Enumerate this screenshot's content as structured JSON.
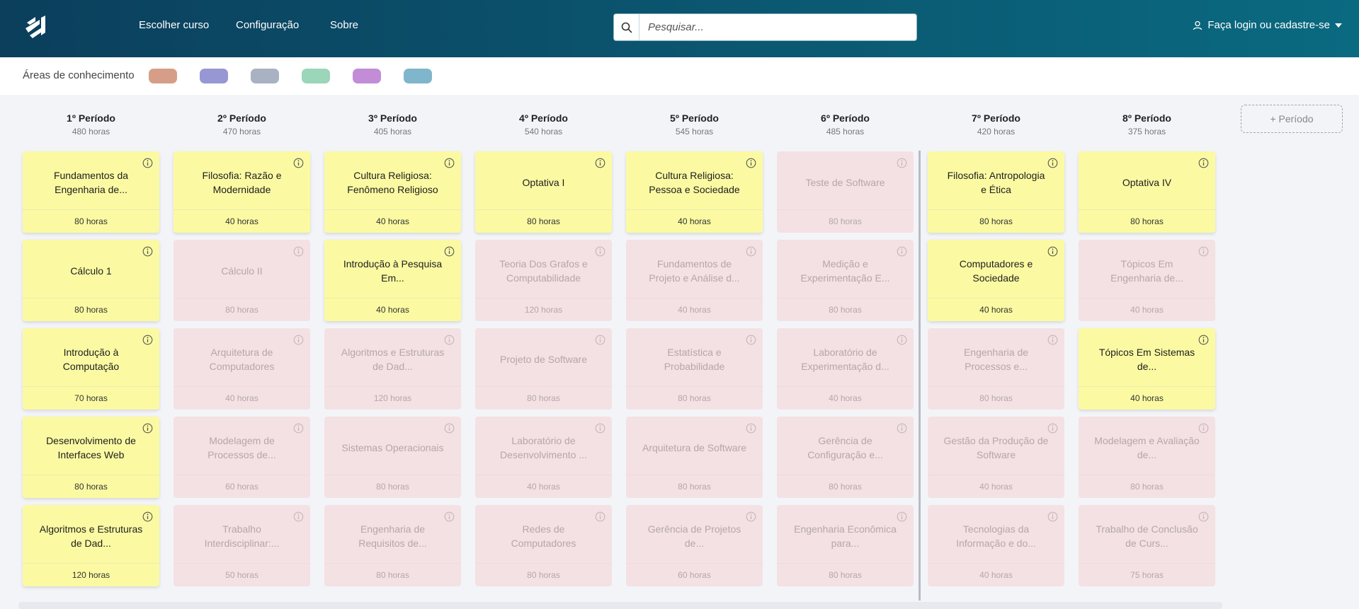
{
  "nav": {
    "items": [
      "Escolher curso",
      "Configuração",
      "Sobre"
    ],
    "search_placeholder": "Pesquisar...",
    "login_label": "Faça login ou cadastre-se"
  },
  "areas": {
    "label": "Áreas de conhecimento",
    "colors": [
      "#d69e88",
      "#9797d3",
      "#a9b2c2",
      "#9bd5ba",
      "#c38cd7",
      "#7fb6cb"
    ]
  },
  "add_period_label": "+ Período",
  "periods": [
    {
      "name": "1º Período",
      "hours": "480 horas",
      "cards": [
        {
          "title": "Fundamentos da Engenharia de...",
          "hours": "80 horas",
          "active": true
        },
        {
          "title": "Cálculo 1",
          "hours": "80 horas",
          "active": true
        },
        {
          "title": "Introdução à Computação",
          "hours": "70 horas",
          "active": true
        },
        {
          "title": "Desenvolvimento de Interfaces Web",
          "hours": "80 horas",
          "active": true
        },
        {
          "title": "Algoritmos e Estruturas de Dad...",
          "hours": "120 horas",
          "active": true
        }
      ]
    },
    {
      "name": "2º Período",
      "hours": "470 horas",
      "cards": [
        {
          "title": "Filosofia: Razão e Modernidade",
          "hours": "40 horas",
          "active": true
        },
        {
          "title": "Cálculo II",
          "hours": "80 horas",
          "active": false
        },
        {
          "title": "Arquitetura de Computadores",
          "hours": "40 horas",
          "active": false
        },
        {
          "title": "Modelagem de Processos de...",
          "hours": "60 horas",
          "active": false
        },
        {
          "title": "Trabalho Interdisciplinar:...",
          "hours": "50 horas",
          "active": false
        }
      ]
    },
    {
      "name": "3º Período",
      "hours": "405 horas",
      "cards": [
        {
          "title": "Cultura Religiosa: Fenômeno Religioso",
          "hours": "40 horas",
          "active": true
        },
        {
          "title": "Introdução à Pesquisa Em...",
          "hours": "40 horas",
          "active": true
        },
        {
          "title": "Algoritmos e Estruturas de Dad...",
          "hours": "120 horas",
          "active": false
        },
        {
          "title": "Sistemas Operacionais",
          "hours": "80 horas",
          "active": false
        },
        {
          "title": "Engenharia de Requisitos de...",
          "hours": "80 horas",
          "active": false
        }
      ]
    },
    {
      "name": "4º Período",
      "hours": "540 horas",
      "cards": [
        {
          "title": "Optativa I",
          "hours": "80 horas",
          "active": true
        },
        {
          "title": "Teoria Dos Grafos e Computabilidade",
          "hours": "120 horas",
          "active": false
        },
        {
          "title": "Projeto de Software",
          "hours": "80 horas",
          "active": false
        },
        {
          "title": "Laboratório de Desenvolvimento ...",
          "hours": "40 horas",
          "active": false
        },
        {
          "title": "Redes de Computadores",
          "hours": "80 horas",
          "active": false
        }
      ]
    },
    {
      "name": "5º Período",
      "hours": "545 horas",
      "cards": [
        {
          "title": "Cultura Religiosa: Pessoa e Sociedade",
          "hours": "40 horas",
          "active": true
        },
        {
          "title": "Fundamentos de Projeto e Análise d...",
          "hours": "40 horas",
          "active": false
        },
        {
          "title": "Estatística e Probabilidade",
          "hours": "80 horas",
          "active": false
        },
        {
          "title": "Arquitetura de Software",
          "hours": "80 horas",
          "active": false
        },
        {
          "title": "Gerência de Projetos de...",
          "hours": "60 horas",
          "active": false
        }
      ]
    },
    {
      "name": "6º Período",
      "hours": "485 horas",
      "cards": [
        {
          "title": "Teste de Software",
          "hours": "80 horas",
          "active": false
        },
        {
          "title": "Medição e Experimentação E...",
          "hours": "80 horas",
          "active": false
        },
        {
          "title": "Laboratório de Experimentação d...",
          "hours": "40 horas",
          "active": false
        },
        {
          "title": "Gerência de Configuração e...",
          "hours": "80 horas",
          "active": false
        },
        {
          "title": "Engenharia Econômica para...",
          "hours": "80 horas",
          "active": false
        }
      ]
    },
    {
      "name": "7º Período",
      "hours": "420 horas",
      "cards": [
        {
          "title": "Filosofia: Antropologia e Ética",
          "hours": "80 horas",
          "active": true
        },
        {
          "title": "Computadores e Sociedade",
          "hours": "40 horas",
          "active": true
        },
        {
          "title": "Engenharia de Processos e...",
          "hours": "80 horas",
          "active": false
        },
        {
          "title": "Gestão da Produção de Software",
          "hours": "40 horas",
          "active": false
        },
        {
          "title": "Tecnologias da Informação e do...",
          "hours": "40 horas",
          "active": false
        }
      ]
    },
    {
      "name": "8º Período",
      "hours": "375 horas",
      "cards": [
        {
          "title": "Optativa IV",
          "hours": "80 horas",
          "active": true
        },
        {
          "title": "Tópicos Em Engenharia de...",
          "hours": "40 horas",
          "active": false
        },
        {
          "title": "Tópicos Em Sistemas de...",
          "hours": "40 horas",
          "active": true
        },
        {
          "title": "Modelagem e Avaliação de...",
          "hours": "80 horas",
          "active": false
        },
        {
          "title": "Trabalho de Conclusão de Curs...",
          "hours": "75 horas",
          "active": false
        }
      ]
    }
  ]
}
